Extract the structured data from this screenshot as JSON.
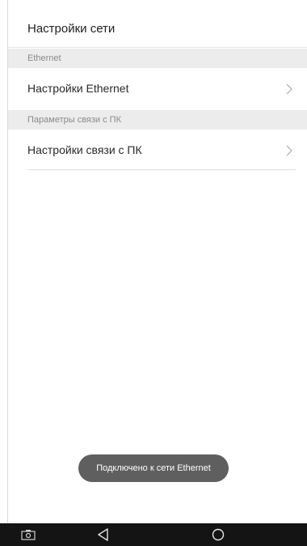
{
  "header": {
    "title": "Настройки сети"
  },
  "sections": [
    {
      "header": "Ethernet",
      "items": [
        {
          "label": "Настройки Ethernet",
          "icon": "chevron-right-icon"
        }
      ]
    },
    {
      "header": "Параметры связи с ПК",
      "items": [
        {
          "label": "Настройки связи с ПК",
          "icon": "chevron-right-icon"
        }
      ]
    }
  ],
  "toast": {
    "message": "Подключено к сети Ethernet"
  },
  "navbar": {
    "buttons": [
      "screenshot-icon",
      "back-icon",
      "home-icon"
    ]
  },
  "colors": {
    "background": "#ffffff",
    "section_header_bg": "#ececec",
    "toast_bg": "#5f5f5f",
    "navbar_bg": "#141414"
  }
}
